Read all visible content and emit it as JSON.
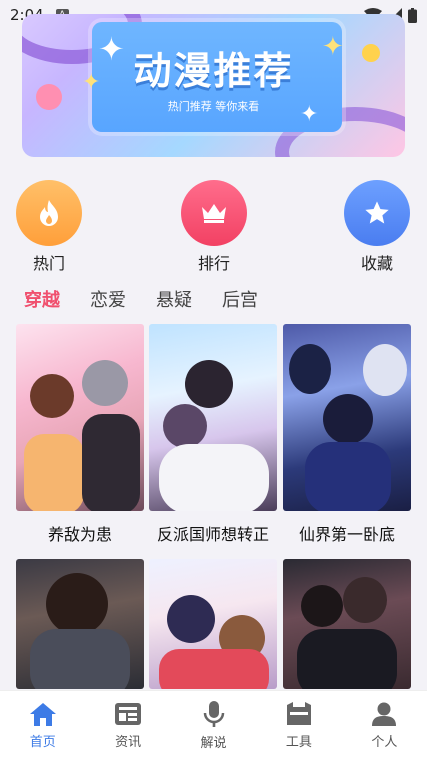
{
  "status": {
    "time": "2:04",
    "a_badge": "A"
  },
  "banner": {
    "title": "动漫推荐",
    "subtitle": "热门推荐  等你来看"
  },
  "quick": [
    {
      "label": "热门",
      "icon": "flame-icon"
    },
    {
      "label": "排行",
      "icon": "crown-icon"
    },
    {
      "label": "收藏",
      "icon": "star-icon"
    }
  ],
  "tabs": [
    {
      "label": "穿越",
      "active": true
    },
    {
      "label": "恋爱"
    },
    {
      "label": "悬疑"
    },
    {
      "label": "后宫"
    }
  ],
  "comics": [
    {
      "title": "养敌为患"
    },
    {
      "title": "反派国师想转正"
    },
    {
      "title": "仙界第一卧底"
    },
    {
      "title": ""
    },
    {
      "title": ""
    },
    {
      "title": ""
    }
  ],
  "nav": [
    {
      "label": "首页",
      "icon": "home-icon",
      "active": true
    },
    {
      "label": "资讯",
      "icon": "news-icon"
    },
    {
      "label": "解说",
      "icon": "microphone-icon"
    },
    {
      "label": "工具",
      "icon": "toolbox-icon"
    },
    {
      "label": "个人",
      "icon": "user-icon"
    }
  ],
  "colors": {
    "accent": "#f0506e",
    "nav_active": "#3d7be6"
  }
}
